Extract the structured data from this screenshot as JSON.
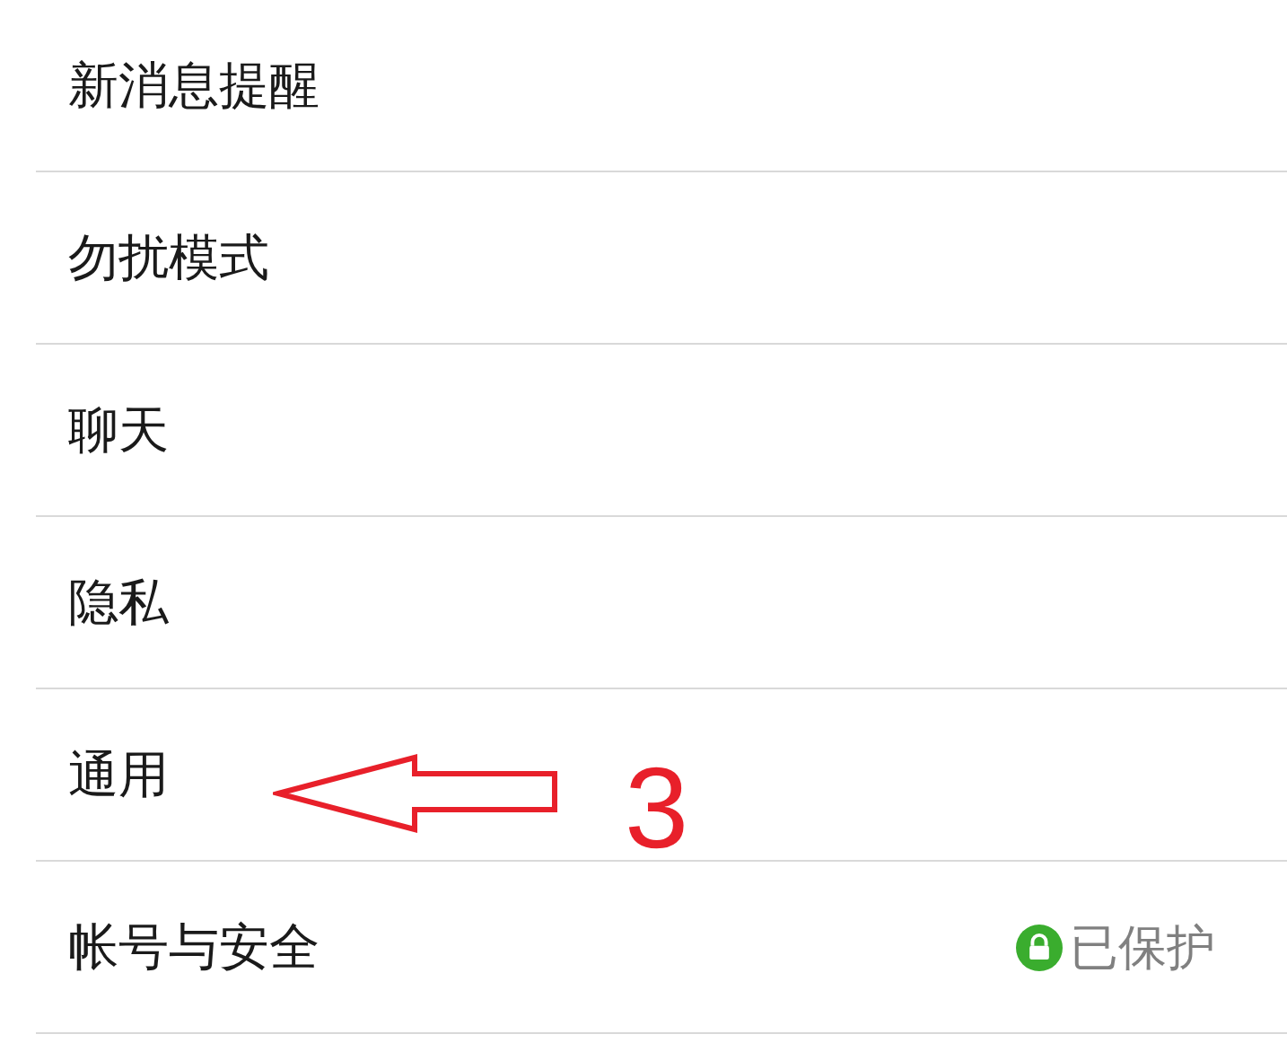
{
  "settings_list": [
    {
      "label": "新消息提醒"
    },
    {
      "label": "勿扰模式"
    },
    {
      "label": "聊天"
    },
    {
      "label": "隐私"
    },
    {
      "label": "通用"
    },
    {
      "label": "帐号与安全",
      "status": {
        "kind": "protected",
        "text": "已保护"
      }
    }
  ],
  "annotation": {
    "kind": "arrow-left",
    "number": "3"
  }
}
